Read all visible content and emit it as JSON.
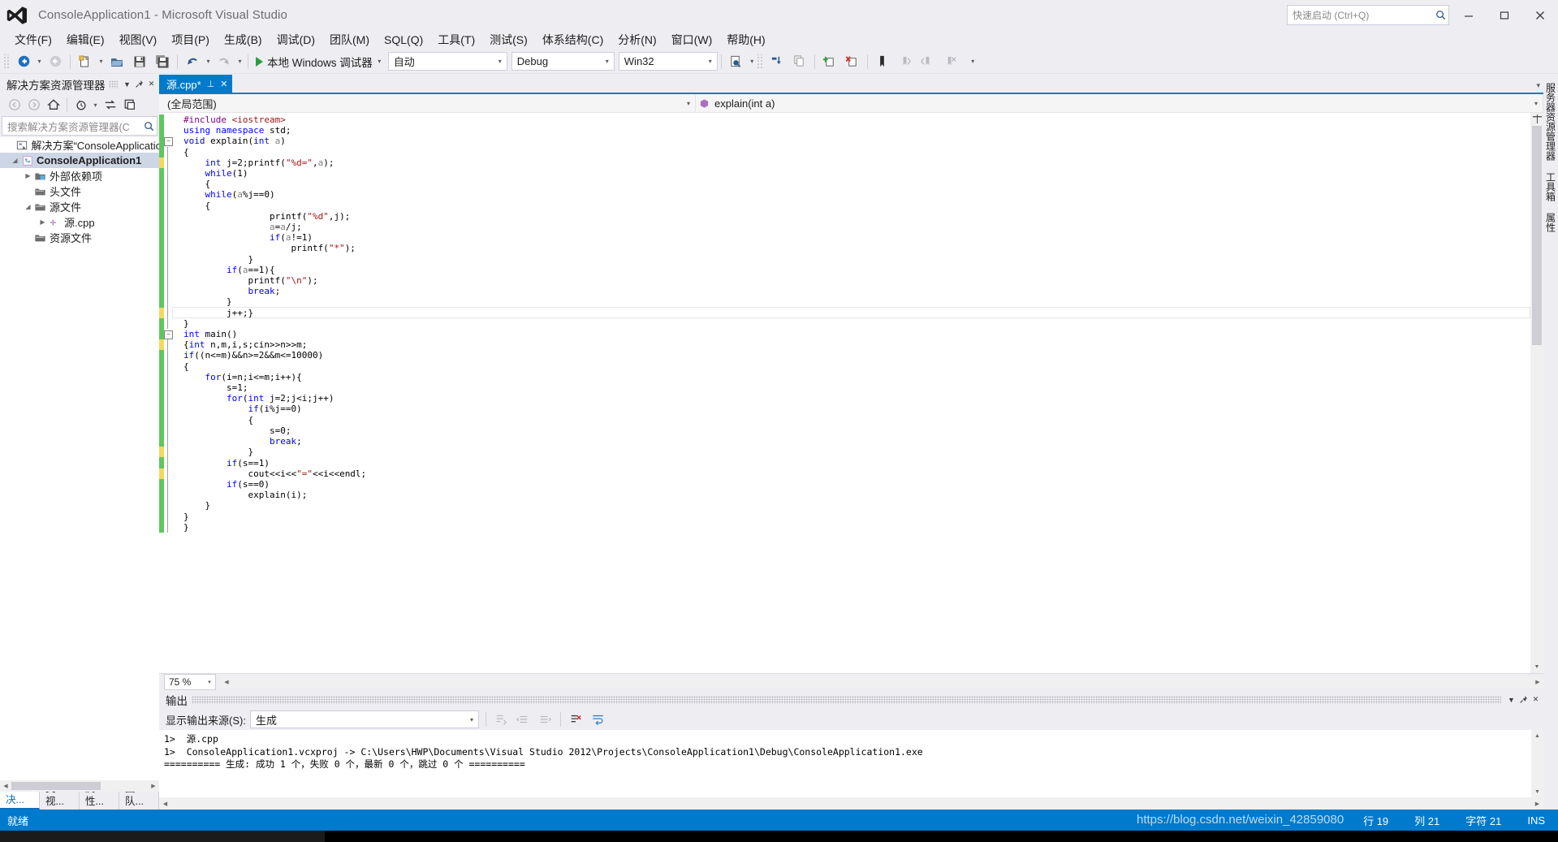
{
  "window": {
    "title": "ConsoleApplication1 - Microsoft Visual Studio",
    "logo_icon": "vs-logo-icon",
    "minimize_label": "—",
    "maximize_label": "□",
    "close_label": "✕"
  },
  "quick_launch": {
    "placeholder": "快速启动 (Ctrl+Q)",
    "icon": "search-icon"
  },
  "menu": [
    {
      "label": "文件(F)"
    },
    {
      "label": "编辑(E)"
    },
    {
      "label": "视图(V)"
    },
    {
      "label": "项目(P)"
    },
    {
      "label": "生成(B)"
    },
    {
      "label": "调试(D)"
    },
    {
      "label": "团队(M)"
    },
    {
      "label": "SQL(Q)"
    },
    {
      "label": "工具(T)"
    },
    {
      "label": "测试(S)"
    },
    {
      "label": "体系结构(C)"
    },
    {
      "label": "分析(N)"
    },
    {
      "label": "窗口(W)"
    },
    {
      "label": "帮助(H)"
    }
  ],
  "toolbar": {
    "back_icon": "navigate-back-icon",
    "forward_icon": "navigate-forward-icon",
    "newproject_icon": "new-project-icon",
    "openfile_icon": "open-file-icon",
    "save_icon": "save-icon",
    "saveall_icon": "save-all-icon",
    "undo_icon": "undo-icon",
    "redo_icon": "redo-icon",
    "run_label": "本地 Windows 调试器",
    "run_icon": "run-play-icon",
    "auto_value": "自动",
    "config_value": "Debug",
    "platform_value": "Win32",
    "find_icon": "find-in-files-icon",
    "step_icon": "step-into-icon",
    "copy_icon": "copy-icon",
    "addnew_icon": "add-item-icon",
    "removeitem_icon": "remove-item-icon",
    "bookmark_icon": "bookmark-icon",
    "prevbookmark_icon": "previous-bookmark-icon",
    "nextbookmark_icon": "next-bookmark-icon",
    "clearbookmark_icon": "clear-bookmark-icon",
    "overflow_icon": "toolbar-overflow-icon"
  },
  "solution_explorer": {
    "title": "解决方案资源管理器",
    "dropdown_icon": "chevron-down-icon",
    "pin_icon": "pin-icon",
    "close_icon": "close-icon",
    "tools": {
      "back_icon": "back-icon",
      "forward_icon": "forward-icon",
      "home_icon": "home-icon",
      "pending_icon": "pending-changes-icon",
      "sync_icon": "sync-with-active-document-icon",
      "properties_icon": "show-all-files-icon"
    },
    "search_placeholder": "搜索解决方案资源管理器(C",
    "search_icon": "search-icon",
    "tree": [
      {
        "label": "解决方案“ConsoleApplicatio",
        "icon": "solution-icon",
        "indent": 0,
        "expander": "none",
        "selected": false
      },
      {
        "label": "ConsoleApplication1",
        "icon": "project-icon",
        "indent": 1,
        "expander": "expanded",
        "selected": true
      },
      {
        "label": "外部依赖项",
        "icon": "folder-dependencies-icon",
        "indent": 2,
        "expander": "collapsed",
        "selected": false
      },
      {
        "label": "头文件",
        "icon": "folder-icon",
        "indent": 2,
        "expander": "none",
        "selected": false
      },
      {
        "label": "源文件",
        "icon": "folder-icon",
        "indent": 2,
        "expander": "expanded",
        "selected": false
      },
      {
        "label": "源.cpp",
        "icon": "cpp-file-icon",
        "indent": 3,
        "expander": "collapsed",
        "selected": false
      },
      {
        "label": "资源文件",
        "icon": "folder-icon",
        "indent": 2,
        "expander": "none",
        "selected": false
      }
    ],
    "bottom_tabs": [
      {
        "label": "解决...",
        "active": true
      },
      {
        "label": "类视...",
        "active": false
      },
      {
        "label": "属性...",
        "active": false
      },
      {
        "label": "团队...",
        "active": false
      }
    ]
  },
  "editor": {
    "tab": {
      "label": "源.cpp*",
      "pin_icon": "pin-icon",
      "close_icon": "close-icon"
    },
    "nav_scope": "(全局范围)",
    "nav_member": "explain(int a)",
    "nav_member_icon": "method-icon",
    "nav_caret_icon": "chevron-down-icon",
    "zoom_level": "75 %",
    "code_lines": [
      {
        "indicator": "save",
        "fold": "none",
        "segments": [
          {
            "t": "#include ",
            "c": "pp"
          },
          {
            "t": "<iostream>",
            "c": "hdr"
          }
        ]
      },
      {
        "indicator": "save",
        "fold": "none",
        "segments": [
          {
            "t": "using",
            "c": "k"
          },
          {
            "t": " ",
            "c": "id"
          },
          {
            "t": "namespace",
            "c": "k"
          },
          {
            "t": " std;",
            "c": "id"
          }
        ]
      },
      {
        "indicator": "save",
        "fold": "open",
        "segments": [
          {
            "t": "void",
            "c": "k"
          },
          {
            "t": " explain(",
            "c": "id"
          },
          {
            "t": "int",
            "c": "k"
          },
          {
            "t": " ",
            "c": "id"
          },
          {
            "t": "a",
            "c": "par"
          },
          {
            "t": ")",
            "c": "id"
          }
        ]
      },
      {
        "indicator": "save",
        "fold": "bar",
        "segments": [
          {
            "t": "{",
            "c": "id"
          }
        ]
      },
      {
        "indicator": "edit",
        "fold": "bar",
        "segments": [
          {
            "t": "    ",
            "c": "id"
          },
          {
            "t": "int",
            "c": "k"
          },
          {
            "t": " j=2;printf(",
            "c": "id"
          },
          {
            "t": "\"%d=\"",
            "c": "str"
          },
          {
            "t": ",",
            "c": "id"
          },
          {
            "t": "a",
            "c": "par"
          },
          {
            "t": ");",
            "c": "id"
          }
        ]
      },
      {
        "indicator": "save",
        "fold": "bar",
        "segments": [
          {
            "t": "    ",
            "c": "id"
          },
          {
            "t": "while",
            "c": "k"
          },
          {
            "t": "(1)",
            "c": "id"
          }
        ]
      },
      {
        "indicator": "save",
        "fold": "bar",
        "segments": [
          {
            "t": "    {",
            "c": "id"
          }
        ]
      },
      {
        "indicator": "save",
        "fold": "bar",
        "segments": [
          {
            "t": "    ",
            "c": "id"
          },
          {
            "t": "while",
            "c": "k"
          },
          {
            "t": "(",
            "c": "id"
          },
          {
            "t": "a",
            "c": "par"
          },
          {
            "t": "%j==0)",
            "c": "id"
          }
        ]
      },
      {
        "indicator": "save",
        "fold": "bar",
        "segments": [
          {
            "t": "    {",
            "c": "id"
          }
        ]
      },
      {
        "indicator": "save",
        "fold": "bar",
        "segments": [
          {
            "t": "                printf(",
            "c": "id"
          },
          {
            "t": "\"%d\"",
            "c": "str"
          },
          {
            "t": ",j);",
            "c": "id"
          }
        ]
      },
      {
        "indicator": "save",
        "fold": "bar",
        "segments": [
          {
            "t": "                ",
            "c": "id"
          },
          {
            "t": "a",
            "c": "par"
          },
          {
            "t": "=",
            "c": "id"
          },
          {
            "t": "a",
            "c": "par"
          },
          {
            "t": "/j;",
            "c": "id"
          }
        ]
      },
      {
        "indicator": "save",
        "fold": "bar",
        "segments": [
          {
            "t": "                ",
            "c": "id"
          },
          {
            "t": "if",
            "c": "k"
          },
          {
            "t": "(",
            "c": "id"
          },
          {
            "t": "a",
            "c": "par"
          },
          {
            "t": "!=1)",
            "c": "id"
          }
        ]
      },
      {
        "indicator": "save",
        "fold": "bar",
        "segments": [
          {
            "t": "                    printf(",
            "c": "id"
          },
          {
            "t": "\"*\"",
            "c": "str"
          },
          {
            "t": ");",
            "c": "id"
          }
        ]
      },
      {
        "indicator": "save",
        "fold": "bar",
        "segments": [
          {
            "t": "            }",
            "c": "id"
          }
        ]
      },
      {
        "indicator": "save",
        "fold": "bar",
        "segments": [
          {
            "t": "        ",
            "c": "id"
          },
          {
            "t": "if",
            "c": "k"
          },
          {
            "t": "(",
            "c": "id"
          },
          {
            "t": "a",
            "c": "par"
          },
          {
            "t": "==1){",
            "c": "id"
          }
        ]
      },
      {
        "indicator": "save",
        "fold": "bar",
        "segments": [
          {
            "t": "            printf(",
            "c": "id"
          },
          {
            "t": "\"\\n\"",
            "c": "str"
          },
          {
            "t": ");",
            "c": "id"
          }
        ]
      },
      {
        "indicator": "save",
        "fold": "bar",
        "segments": [
          {
            "t": "            ",
            "c": "id"
          },
          {
            "t": "break",
            "c": "k"
          },
          {
            "t": ";",
            "c": "id"
          }
        ]
      },
      {
        "indicator": "save",
        "fold": "bar",
        "segments": [
          {
            "t": "        }",
            "c": "id"
          }
        ]
      },
      {
        "indicator": "edit",
        "fold": "bar",
        "current": true,
        "segments": [
          {
            "t": "        j++;}",
            "c": "id"
          }
        ]
      },
      {
        "indicator": "save",
        "fold": "bar",
        "segments": [
          {
            "t": "}",
            "c": "id"
          }
        ]
      },
      {
        "indicator": "save",
        "fold": "open",
        "segments": [
          {
            "t": "int",
            "c": "k"
          },
          {
            "t": " main()",
            "c": "id"
          }
        ]
      },
      {
        "indicator": "edit",
        "fold": "bar",
        "segments": [
          {
            "t": "{",
            "c": "id"
          },
          {
            "t": "int",
            "c": "k"
          },
          {
            "t": " n,m,i,s;cin>>n>>m;",
            "c": "id"
          }
        ]
      },
      {
        "indicator": "save",
        "fold": "bar",
        "segments": [
          {
            "t": "if",
            "c": "k"
          },
          {
            "t": "((n<=m)&&n>=2&&m<=10000)",
            "c": "id"
          }
        ]
      },
      {
        "indicator": "save",
        "fold": "bar",
        "segments": [
          {
            "t": "{",
            "c": "id"
          }
        ]
      },
      {
        "indicator": "save",
        "fold": "bar",
        "segments": [
          {
            "t": "    ",
            "c": "id"
          },
          {
            "t": "for",
            "c": "k"
          },
          {
            "t": "(i=n;i<=m;i++){",
            "c": "id"
          }
        ]
      },
      {
        "indicator": "save",
        "fold": "bar",
        "segments": [
          {
            "t": "        s=1;",
            "c": "id"
          }
        ]
      },
      {
        "indicator": "save",
        "fold": "bar",
        "segments": [
          {
            "t": "        ",
            "c": "id"
          },
          {
            "t": "for",
            "c": "k"
          },
          {
            "t": "(",
            "c": "id"
          },
          {
            "t": "int",
            "c": "k"
          },
          {
            "t": " j=2;j<i;j++)",
            "c": "id"
          }
        ]
      },
      {
        "indicator": "save",
        "fold": "bar",
        "segments": [
          {
            "t": "            ",
            "c": "id"
          },
          {
            "t": "if",
            "c": "k"
          },
          {
            "t": "(i%j==0)",
            "c": "id"
          }
        ]
      },
      {
        "indicator": "save",
        "fold": "bar",
        "segments": [
          {
            "t": "            {",
            "c": "id"
          }
        ]
      },
      {
        "indicator": "save",
        "fold": "bar",
        "segments": [
          {
            "t": "                s=0;",
            "c": "id"
          }
        ]
      },
      {
        "indicator": "save",
        "fold": "bar",
        "segments": [
          {
            "t": "                ",
            "c": "id"
          },
          {
            "t": "break",
            "c": "k"
          },
          {
            "t": ";",
            "c": "id"
          }
        ]
      },
      {
        "indicator": "edit",
        "fold": "bar",
        "segments": [
          {
            "t": "            }",
            "c": "id"
          }
        ]
      },
      {
        "indicator": "save",
        "fold": "bar",
        "segments": [
          {
            "t": "        ",
            "c": "id"
          },
          {
            "t": "if",
            "c": "k"
          },
          {
            "t": "(s==1)",
            "c": "id"
          }
        ]
      },
      {
        "indicator": "edit",
        "fold": "bar",
        "segments": [
          {
            "t": "            cout<<i<<",
            "c": "id"
          },
          {
            "t": "\"=\"",
            "c": "str"
          },
          {
            "t": "<<i<<endl;",
            "c": "id"
          }
        ]
      },
      {
        "indicator": "save",
        "fold": "bar",
        "segments": [
          {
            "t": "        ",
            "c": "id"
          },
          {
            "t": "if",
            "c": "k"
          },
          {
            "t": "(s==0)",
            "c": "id"
          }
        ]
      },
      {
        "indicator": "save",
        "fold": "bar",
        "segments": [
          {
            "t": "            explain(i);",
            "c": "id"
          }
        ]
      },
      {
        "indicator": "save",
        "fold": "bar",
        "segments": [
          {
            "t": "    }",
            "c": "id"
          }
        ]
      },
      {
        "indicator": "save",
        "fold": "bar",
        "segments": [
          {
            "t": "}",
            "c": "id"
          }
        ]
      },
      {
        "indicator": "save",
        "fold": "bar",
        "segments": [
          {
            "t": "}",
            "c": "id"
          }
        ]
      }
    ]
  },
  "output": {
    "title": "输出",
    "dropdown_icon": "chevron-down-icon",
    "pin_icon": "pin-icon",
    "close_icon": "close-icon",
    "source_label": "显示输出来源(S):",
    "source_value": "生成",
    "tools": {
      "goto_message_icon": "go-to-message-icon",
      "prev_icon": "previous-message-icon",
      "next_icon": "next-message-icon",
      "clear_icon": "clear-all-icon",
      "wordwrap_icon": "toggle-word-wrap-icon"
    },
    "lines": [
      "1>  源.cpp",
      "1>  ConsoleApplication1.vcxproj -> C:\\Users\\HWP\\Documents\\Visual Studio 2012\\Projects\\ConsoleApplication1\\Debug\\ConsoleApplication1.exe",
      "========== 生成: 成功 1 个，失败 0 个，最新 0 个，跳过 0 个 =========="
    ]
  },
  "right_dock": [
    {
      "label": "服务器资源管理器"
    },
    {
      "label": "工具箱"
    },
    {
      "label": "属性"
    }
  ],
  "status_bar": {
    "ready": "就绪",
    "line_label": "行 19",
    "col_label": "列 21",
    "char_label": "字符 21",
    "ins_label": "INS",
    "watermark": "https://blog.csdn.net/weixin_42859080"
  },
  "colors": {
    "accent": "#007acc",
    "chrome": "#eeeef2",
    "keyword": "#0000ff",
    "string": "#a31515",
    "preprocessor": "#800080",
    "saved_indicator": "#5ec85e",
    "edited_indicator": "#f2da5c",
    "selection": "#cdd6e5"
  }
}
